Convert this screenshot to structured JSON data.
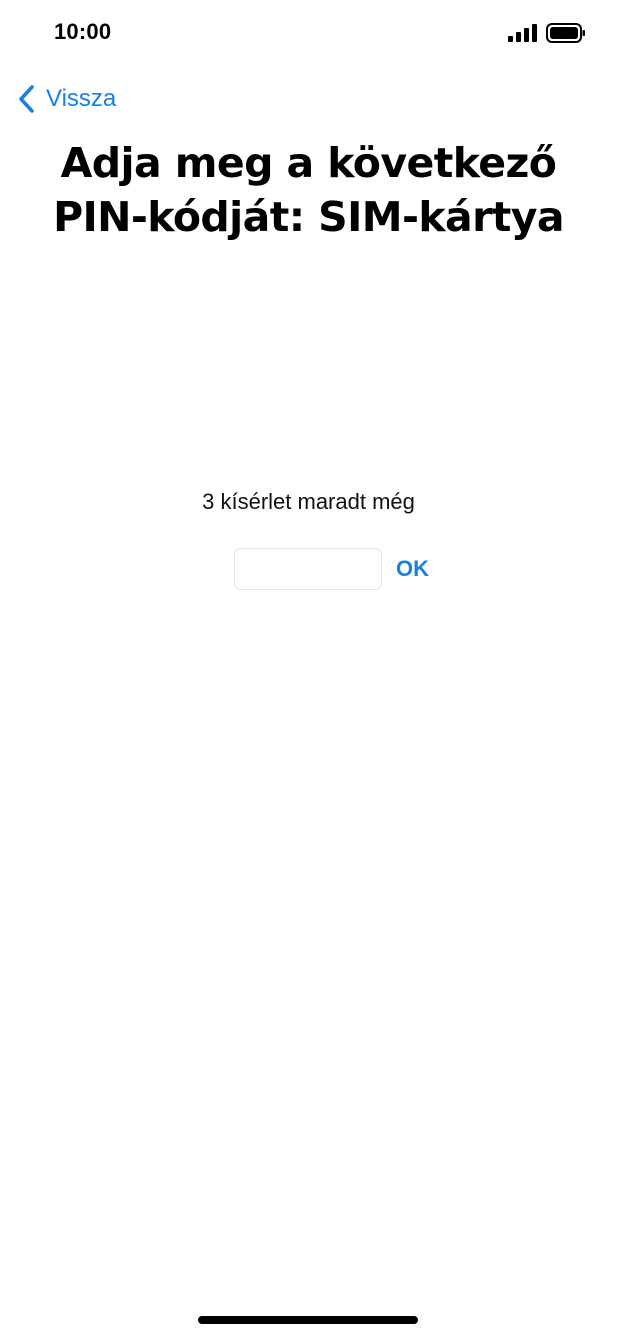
{
  "status_bar": {
    "time": "10:00",
    "signal_icon": "cellular-signal-icon",
    "battery_icon": "battery-full-icon"
  },
  "nav": {
    "back_label": "Vissza",
    "back_icon": "chevron-left-icon",
    "accent_color": "#1c7fdd"
  },
  "title": "Adja meg a következő PIN-kódját: SIM-kártya",
  "attempts_text": "3 kísérlet maradt még",
  "pin": {
    "value": "",
    "placeholder": ""
  },
  "ok_label": "OK"
}
